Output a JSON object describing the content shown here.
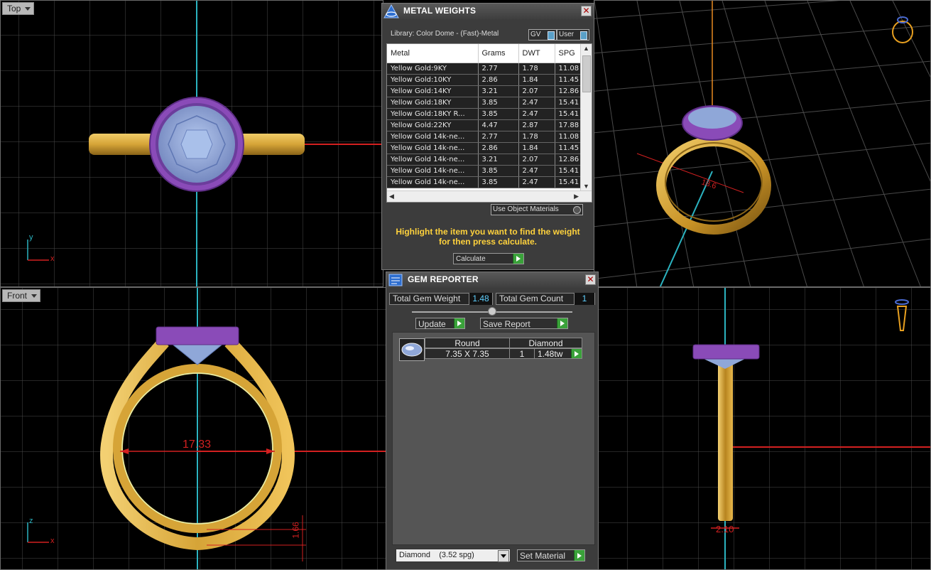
{
  "viewports": {
    "top": {
      "label": "Top",
      "axis_a": "y",
      "axis_b": "x"
    },
    "front": {
      "label": "Front",
      "axis_a": "z",
      "axis_b": "x",
      "dimension_main": "17.33",
      "dimension_small": "1.66"
    },
    "perspective": {
      "dimension": "18.6"
    },
    "right": {
      "dimension": "2.10"
    }
  },
  "metal_weights": {
    "title": "METAL WEIGHTS",
    "library": "Library: Color Dome - (Fast)-Metal",
    "gv_label": "GV",
    "user_label": "User",
    "columns": [
      "Metal",
      "Grams",
      "DWT",
      "SPG"
    ],
    "rows": [
      [
        "Yellow Gold:9KY",
        "2.77",
        "1.78",
        "11.08"
      ],
      [
        "Yellow Gold:10KY",
        "2.86",
        "1.84",
        "11.45"
      ],
      [
        "Yellow Gold:14KY",
        "3.21",
        "2.07",
        "12.86"
      ],
      [
        "Yellow Gold:18KY",
        "3.85",
        "2.47",
        "15.41"
      ],
      [
        "Yellow Gold:18KY R...",
        "3.85",
        "2.47",
        "15.41"
      ],
      [
        "Yellow Gold:22KY",
        "4.47",
        "2.87",
        "17.88"
      ],
      [
        "Yellow Gold 14k-ne...",
        "2.77",
        "1.78",
        "11.08"
      ],
      [
        "Yellow Gold 14k-ne...",
        "2.86",
        "1.84",
        "11.45"
      ],
      [
        "Yellow Gold 14k-ne...",
        "3.21",
        "2.07",
        "12.86"
      ],
      [
        "Yellow Gold 14k-ne...",
        "3.85",
        "2.47",
        "15.41"
      ],
      [
        "Yellow Gold 14k-ne...",
        "3.85",
        "2.47",
        "15.41"
      ]
    ],
    "use_object_materials": "Use Object Materials",
    "instruction_line1": "Highlight the item you want to find the weight",
    "instruction_line2": "for then press calculate.",
    "calculate_label": "Calculate"
  },
  "gem_reporter": {
    "title": "GEM REPORTER",
    "total_weight_label": "Total Gem Weight",
    "total_weight_value": "1.48",
    "total_count_label": "Total Gem Count",
    "total_count_value": "1",
    "update_label": "Update",
    "save_report_label": "Save Report",
    "gem": {
      "shape": "Round",
      "size": "7.35 X 7.35",
      "material": "Diamond",
      "count": "1",
      "weight": "1.48tw"
    },
    "material_select": "Diamond    (3.52 spg)",
    "set_material_label": "Set Material"
  },
  "colors": {
    "gold": "#d9a83a",
    "bezel_purple": "#8a4bb8",
    "gem_blue": "#8fa7d8",
    "axis_cyan": "#2bb3c0",
    "axis_red": "#d22020",
    "instruction_yellow": "#ffd23c",
    "play_green": "#3aa23a"
  }
}
